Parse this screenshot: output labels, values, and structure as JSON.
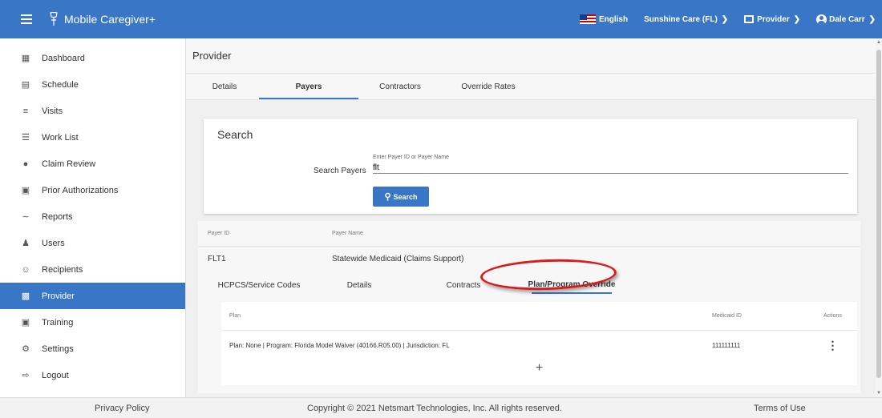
{
  "header": {
    "app_title": "Mobile Caregiver+",
    "language": "English",
    "agency": "Sunshine Care (FL)",
    "role": "Provider",
    "user": "Dale Carr"
  },
  "sidebar": {
    "items": [
      {
        "label": "Dashboard",
        "icon": "dashboard-icon"
      },
      {
        "label": "Schedule",
        "icon": "schedule-icon"
      },
      {
        "label": "Visits",
        "icon": "visits-icon"
      },
      {
        "label": "Work List",
        "icon": "list-icon"
      },
      {
        "label": "Claim Review",
        "icon": "alert-icon"
      },
      {
        "label": "Prior Authorizations",
        "icon": "calendar-icon"
      },
      {
        "label": "Reports",
        "icon": "chart-icon"
      },
      {
        "label": "Users",
        "icon": "users-icon"
      },
      {
        "label": "Recipients",
        "icon": "recipients-icon"
      },
      {
        "label": "Provider",
        "icon": "clipboard-icon"
      },
      {
        "label": "Training",
        "icon": "training-icon"
      },
      {
        "label": "Settings",
        "icon": "gear-icon"
      },
      {
        "label": "Logout",
        "icon": "logout-icon"
      }
    ],
    "active": "Provider"
  },
  "main": {
    "page_title": "Provider",
    "tabs": [
      "Details",
      "Payers",
      "Contractors",
      "Override Rates"
    ],
    "active_tab": "Payers",
    "search": {
      "title": "Search",
      "label": "Search Payers",
      "hint": "Enter Payer ID or Payer Name",
      "value": "flt",
      "button": "Search"
    },
    "results": {
      "headers": [
        "Payer ID",
        "Payer Name"
      ],
      "row": {
        "payer_id": "FLT1",
        "payer_name": "Statewide Medicaid (Claims Support)"
      }
    },
    "subtabs": [
      "HCPCS/Service Codes",
      "Details",
      "Contracts",
      "Plan/Program Override"
    ],
    "active_subtab": "Plan/Program Override",
    "plan_table": {
      "headers": [
        "Plan",
        "Medicaid ID",
        "Actions"
      ],
      "row": {
        "plan": "Plan: None | Program: Florida Model Waiver (40166.R05.00) | Jurisdiction: FL",
        "medicaid_id": "111111111"
      },
      "add_label": "+"
    }
  },
  "footer": {
    "privacy": "Privacy Policy",
    "copyright": "Copyright © 2021 Netsmart Technologies, Inc. All rights reserved.",
    "terms": "Terms of Use"
  },
  "colors": {
    "primary": "#3a76c6",
    "highlight": "#d81c1c"
  }
}
